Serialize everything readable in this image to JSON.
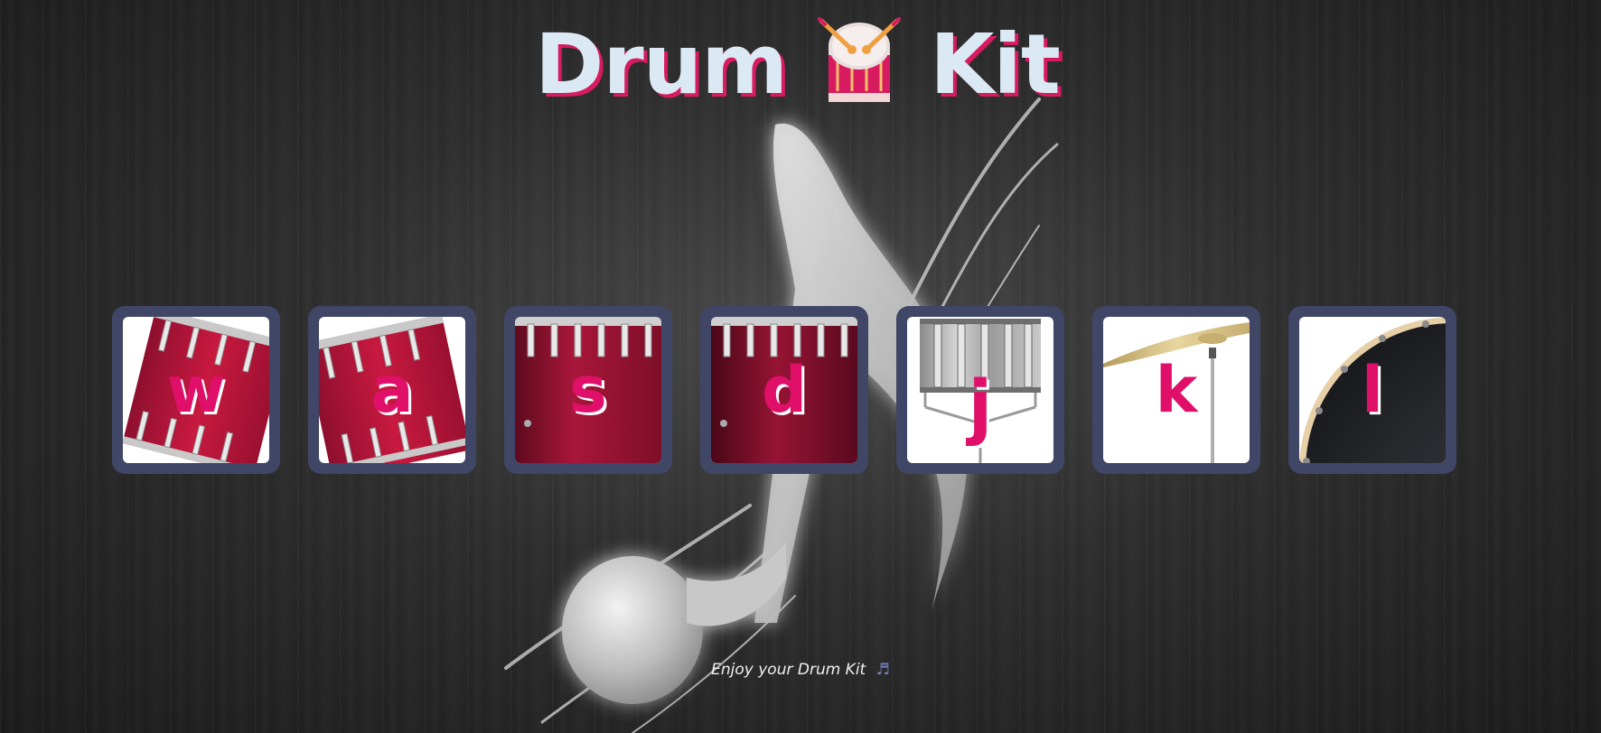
{
  "header": {
    "title_word1": "Drum",
    "title_icon": "drum-with-sticks-icon",
    "title_word2": "Kit"
  },
  "pads": [
    {
      "key": "w",
      "instrument": "tom-drum",
      "icon": "tom-drum-icon"
    },
    {
      "key": "a",
      "instrument": "tom-drum",
      "icon": "tom-drum-icon"
    },
    {
      "key": "s",
      "instrument": "floor-tom",
      "icon": "floor-tom-icon"
    },
    {
      "key": "d",
      "instrument": "floor-tom",
      "icon": "floor-tom-icon"
    },
    {
      "key": "j",
      "instrument": "snare",
      "icon": "snare-drum-icon"
    },
    {
      "key": "k",
      "instrument": "crash-cymbal",
      "icon": "cymbal-icon"
    },
    {
      "key": "l",
      "instrument": "kick-drum",
      "icon": "kick-drum-icon"
    }
  ],
  "footer": {
    "text": "Enjoy your Drum Kit",
    "icon": "music-note-icon",
    "icon_glyph": "♬"
  },
  "colors": {
    "accent": "#e0106a",
    "title_text": "#dbe9f4",
    "pad_border": "#3f4666",
    "drum_red": "#b5173f",
    "background": "#262626"
  }
}
